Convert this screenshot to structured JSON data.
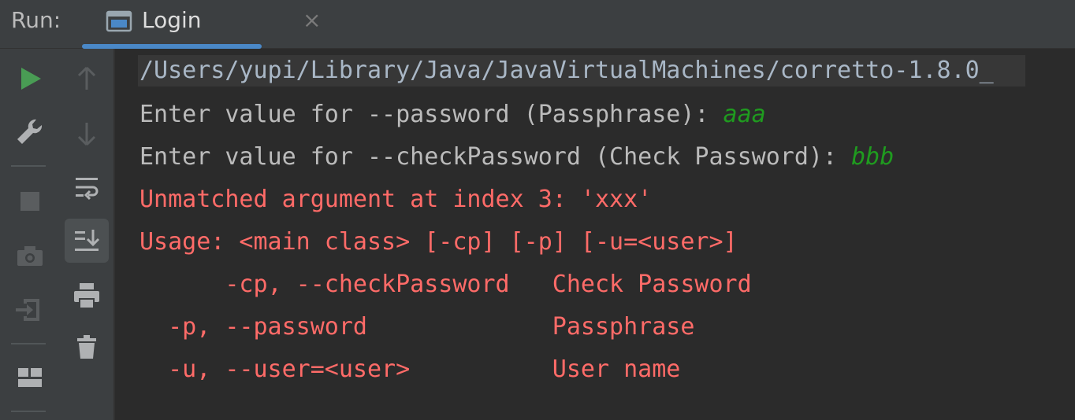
{
  "runbar": {
    "run_label": "Run:",
    "tab_label": "Login",
    "close_glyph": "×",
    "tab_icon": "console-window-icon",
    "accent": "#4a88c7"
  },
  "toolbar": {
    "left": [
      "rerun-icon",
      "wrench-icon",
      "stop-icon",
      "camera-icon",
      "exit-icon",
      "layout-icon"
    ],
    "right": [
      "arrow-up-icon",
      "arrow-down-icon",
      "soft-wrap-icon",
      "scroll-to-end-icon",
      "print-icon",
      "trash-icon"
    ]
  },
  "console": {
    "command": "/Users/yupi/Library/Java/JavaVirtualMachines/corretto-1.8.0_",
    "prompt1": "Enter value for --password (Passphrase): ",
    "input1": "aaa",
    "prompt2": "Enter value for --checkPassword (Check Password): ",
    "input2": "bbb",
    "error1": "Unmatched argument at index 3: 'xxx'",
    "usage": "Usage: <main class> [-cp] [-p] [-u=<user>]",
    "opt1": "      -cp, --checkPassword   Check Password",
    "opt2": "  -p, --password             Passphrase",
    "opt3": "  -u, --user=<user>          User name",
    "colors": {
      "output": "#bbbbbb",
      "error": "#ff6b68",
      "user_input": "#1f9b1f"
    }
  }
}
